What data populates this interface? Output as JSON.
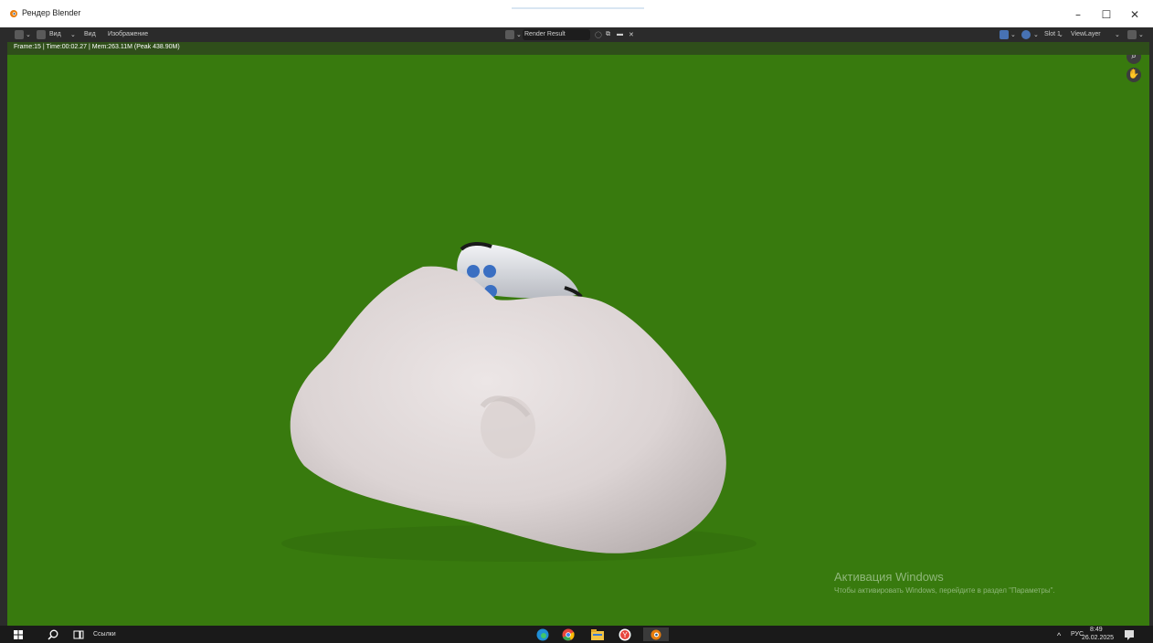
{
  "window": {
    "title": "Рендер Blender"
  },
  "header": {
    "view_menu_1": "Вид",
    "view_menu_2": "Вид",
    "image_menu": "Изображение",
    "image_name": "Render Result",
    "slot": "Slot 1",
    "view_layer": "ViewLayer"
  },
  "render_info": "Frame:15 | Time:00:02.27 | Mem:263.11M (Peak 438.90M)",
  "watermark": {
    "title": "Активация Windows",
    "subtitle": "Чтобы активировать Windows, перейдите в раздел \"Параметры\"."
  },
  "taskbar": {
    "search_label": "Ссылки",
    "lang": "РУС",
    "time": "8:49",
    "date": "26.02.2025"
  },
  "colors": {
    "viewport_bg": "#387a0e",
    "header_bg": "#2b2b2b",
    "accent": "#4772b3"
  },
  "icons": [
    "blender-icon",
    "image-editor-icon",
    "zoom-icon",
    "hand-icon",
    "windows-start-icon",
    "search-icon",
    "task-view-icon",
    "edge-icon",
    "chrome-icon",
    "file-explorer-icon",
    "yandex-icon",
    "blender-taskbar-icon",
    "notification-icon"
  ]
}
